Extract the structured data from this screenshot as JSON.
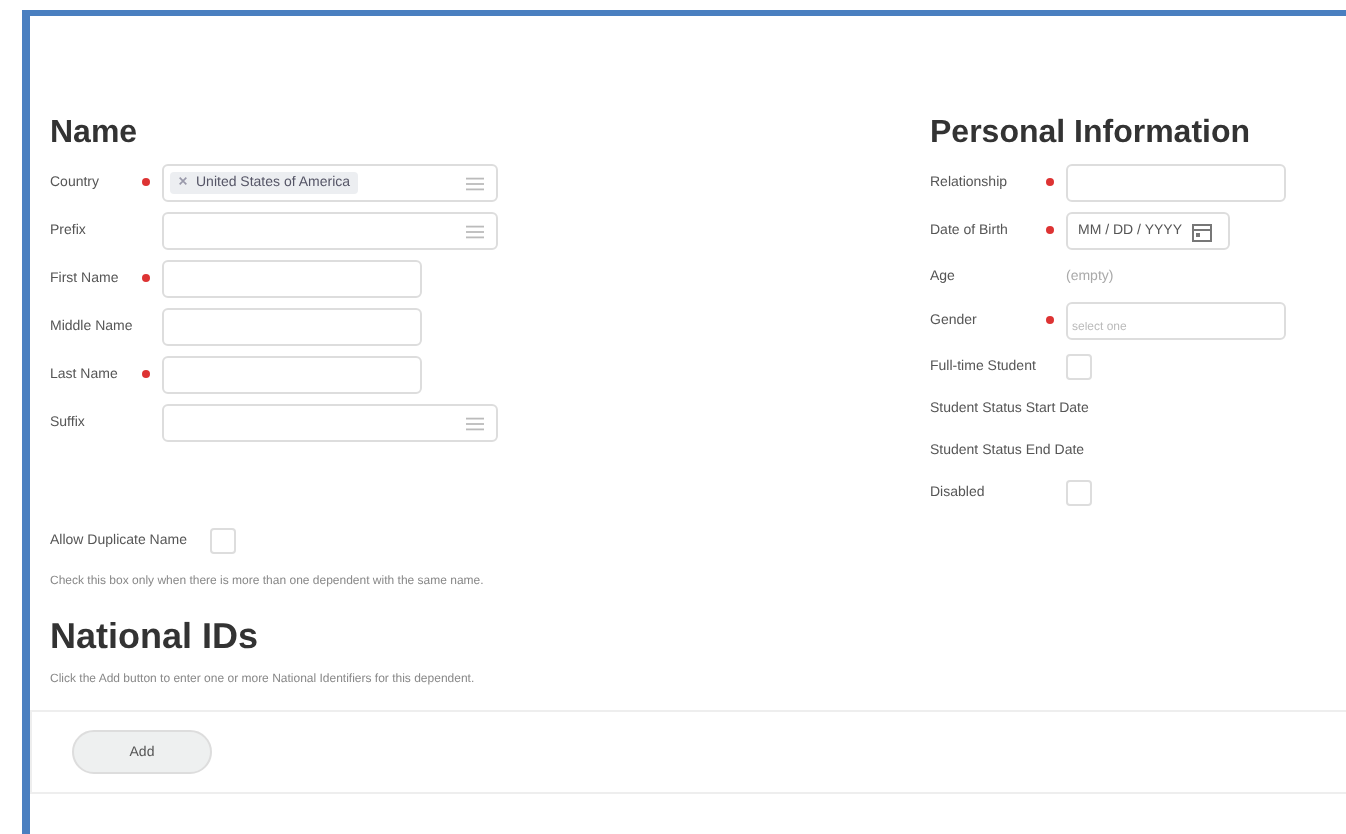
{
  "name_section": {
    "title": "Name",
    "fields": [
      {
        "label": "Country",
        "required": true,
        "kind": "select",
        "token": "United States of America"
      },
      {
        "label": "Prefix",
        "required": false,
        "kind": "select"
      },
      {
        "label": "First Name",
        "required": true,
        "kind": "text"
      },
      {
        "label": "Middle Name",
        "required": false,
        "kind": "text"
      },
      {
        "label": "Last Name",
        "required": true,
        "kind": "text"
      },
      {
        "label": "Suffix",
        "required": false,
        "kind": "select"
      }
    ],
    "duplicate": {
      "label": "Allow Duplicate Name",
      "checked": false
    },
    "help": "Check this box only when there is more than one dependent with the same name."
  },
  "national_ids": {
    "title": "National IDs",
    "help": "Click the Add button to enter one or more National Identifiers for this dependent.",
    "button": "Add"
  },
  "personal_information": {
    "title": "Personal Information",
    "fields": [
      {
        "label": "Relationship",
        "required": true,
        "kind": "text"
      },
      {
        "label": "Date of Birth",
        "required": true,
        "kind": "date",
        "placeholder": "MM / DD / YYYY"
      },
      {
        "label": "Age",
        "required": false,
        "kind": "static",
        "value": "(empty)"
      },
      {
        "label": "Gender",
        "required": true,
        "kind": "text",
        "placeholder": "select one"
      },
      {
        "label": "Full-time Student",
        "required": false,
        "kind": "checkbox",
        "checked": false
      },
      {
        "label": "Student Status Start Date",
        "required": false,
        "kind": "label"
      },
      {
        "label": "Student Status End Date",
        "required": false,
        "kind": "label"
      },
      {
        "label": "Disabled",
        "required": false,
        "kind": "checkbox",
        "checked": false
      }
    ]
  }
}
